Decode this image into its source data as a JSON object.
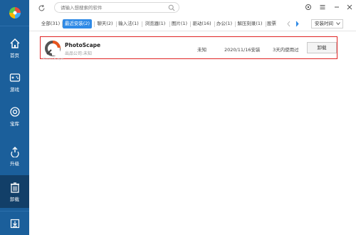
{
  "sidebar": {
    "items": [
      {
        "key": "home",
        "label": "首页",
        "icon": "home-icon"
      },
      {
        "key": "games",
        "label": "游戏",
        "icon": "gamepad-icon"
      },
      {
        "key": "store",
        "label": "宝库",
        "icon": "treasure-icon"
      },
      {
        "key": "upgrade",
        "label": "升级",
        "icon": "upgrade-icon"
      },
      {
        "key": "uninstall",
        "label": "卸载",
        "icon": "trash-icon"
      }
    ],
    "active": "uninstall"
  },
  "search": {
    "placeholder": "请输入想搜索的软件"
  },
  "tabs": [
    {
      "label": "全部(31)"
    },
    {
      "label": "最近安装(2)"
    },
    {
      "label": "聊天(2)"
    },
    {
      "label": "输入法(1)"
    },
    {
      "label": "浏览器(1)"
    },
    {
      "label": "图片(1)"
    },
    {
      "label": "驱动(16)"
    },
    {
      "label": "办公(1)"
    },
    {
      "label": "解压刻录(1)"
    },
    {
      "label": "股票"
    }
  ],
  "active_tab": 1,
  "sort": {
    "label": "安装时间"
  },
  "app": {
    "name": "PhotoScape",
    "publisher": "出品公司:未知",
    "size": "未知",
    "install_date": "2020/11/16安装",
    "last_used": "3天内使用过",
    "uninstall_label": "卸载",
    "watermark": "PhotoScape"
  },
  "colors": {
    "sidebar": "#1b5f9b",
    "sidebar_active": "#123f68",
    "tab_active": "#2f8ae6",
    "highlight": "#e02424"
  }
}
